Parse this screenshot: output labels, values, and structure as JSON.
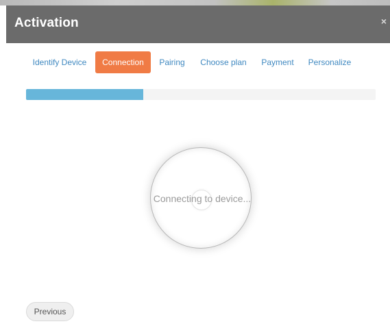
{
  "modal": {
    "title": "Activation",
    "close_label": "×"
  },
  "steps": [
    {
      "label": "Identify Device",
      "active": false
    },
    {
      "label": "Connection",
      "active": true
    },
    {
      "label": "Pairing",
      "active": false
    },
    {
      "label": "Choose plan",
      "active": false
    },
    {
      "label": "Payment",
      "active": false
    },
    {
      "label": "Personalize",
      "active": false
    }
  ],
  "progress": {
    "fraction": 0.335
  },
  "status": {
    "text": "Connecting to device..."
  },
  "footer": {
    "previous_label": "Previous"
  },
  "colors": {
    "header_bg": "#6b6b6b",
    "active_step_bg": "#f07b45",
    "step_link": "#3f88c0",
    "progress_fill": "#67b6da"
  }
}
